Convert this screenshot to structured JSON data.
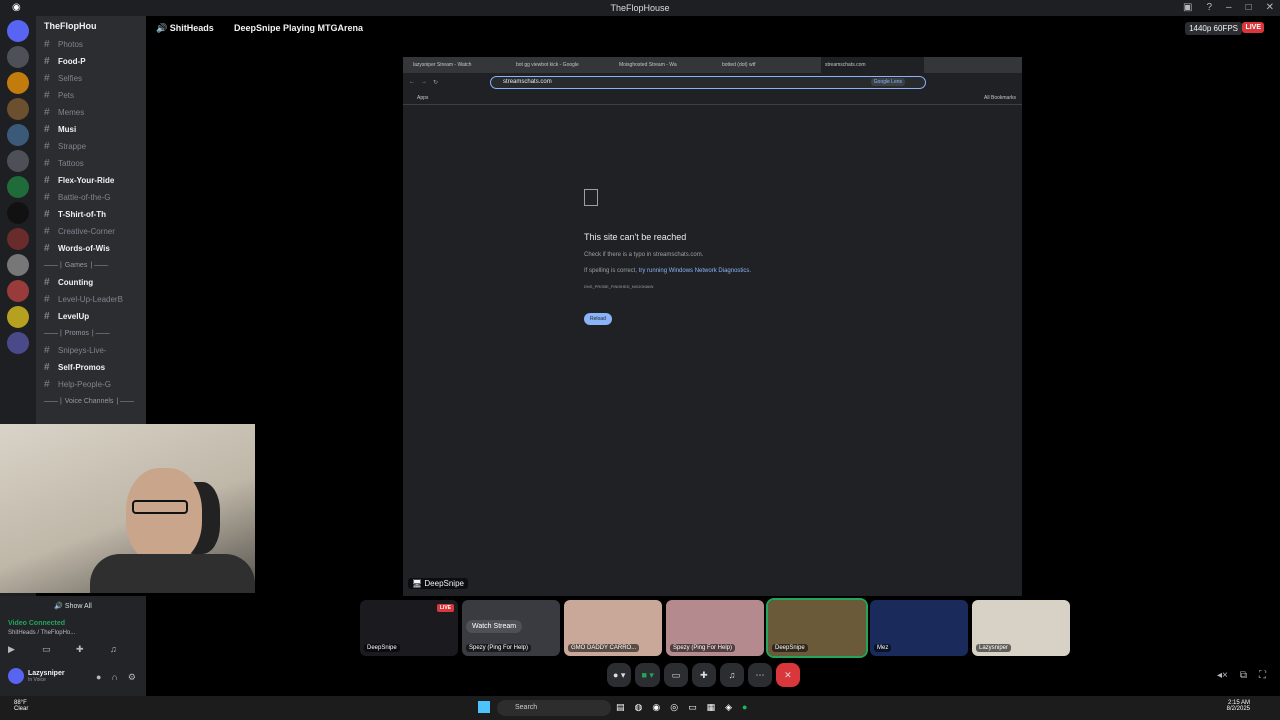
{
  "window": {
    "title": "TheFlopHouse"
  },
  "server": {
    "name": "TheFlopHou"
  },
  "channels": [
    {
      "label": "Photos",
      "unread": false
    },
    {
      "label": "Food-P",
      "unread": true
    },
    {
      "label": "Selfies",
      "unread": false
    },
    {
      "label": "Pets",
      "unread": false
    },
    {
      "label": "Memes",
      "unread": false
    },
    {
      "label": "Musi",
      "unread": true
    },
    {
      "label": "Strappe",
      "unread": false
    },
    {
      "label": "Tattoos",
      "unread": false
    },
    {
      "label": "Flex-Your-Ride",
      "unread": true
    },
    {
      "label": "Battle-of-the-G",
      "unread": false
    },
    {
      "label": "T-Shirt-of-Th",
      "unread": true
    },
    {
      "label": "Creative-Corner",
      "unread": false
    },
    {
      "label": "Words-of-Wis",
      "unread": true
    }
  ],
  "category_games": "Games",
  "games_channels": [
    {
      "label": "Counting",
      "unread": true
    },
    {
      "label": "Level-Up-LeaderB",
      "unread": false
    },
    {
      "label": "LevelUp",
      "unread": true
    }
  ],
  "category_promos": "Promos",
  "promo_channels": [
    {
      "label": "Snipeys-Live-",
      "unread": false
    },
    {
      "label": "Self-Promos",
      "unread": true
    },
    {
      "label": "Help-People-G",
      "unread": false
    }
  ],
  "category_voice": "Voice Channels",
  "topbar": {
    "voice_channel": "ShitHeads",
    "activity": "DeepSnipe Playing MTGArena",
    "quality": "1440p 60FPS",
    "live": "LIVE"
  },
  "browser": {
    "tabs": [
      "lazysniper Stream - Watch",
      "bot gg viewbot kick - Google",
      "Moisghosted Stream - Wa",
      "botted (dot) wtf",
      "streamschats.com"
    ],
    "url": "streamschats.com",
    "lens": "Google Lens",
    "apps": "Apps",
    "all_bookmarks": "All Bookmarks",
    "error_title": "This site can't be reached",
    "error_line1": "Check if there is a typo in streamschats.com.",
    "error_line2_prefix": "If spelling is correct,",
    "error_line2_link": "try running Windows Network Diagnostics.",
    "error_code": "DNS_PROBE_FINISHED_NXDOMAIN",
    "reload": "Reload"
  },
  "streamer_tag": "DeepSnipe",
  "panel": {
    "show_all": "Show All",
    "connected": "Video Connected",
    "location": "ShitHeads / TheFlopHo...",
    "username": "Lazysniper",
    "status": "In Voice"
  },
  "tiles": [
    {
      "label": "DeepSnipe",
      "live": "LIVE"
    },
    {
      "label": "Spezy (Ping For Help)",
      "watch": "Watch Stream"
    },
    {
      "label": "GMO DADDY CARRO..."
    },
    {
      "label": "Spezy (Ping For Help)"
    },
    {
      "label": "DeepSnipe"
    },
    {
      "label": "Mez"
    },
    {
      "label": "Lazysniper"
    }
  ],
  "taskbar": {
    "temp": "88°F",
    "weather": "Clear",
    "search": "Search",
    "time": "2:15 AM",
    "date": "8/2/2025"
  }
}
